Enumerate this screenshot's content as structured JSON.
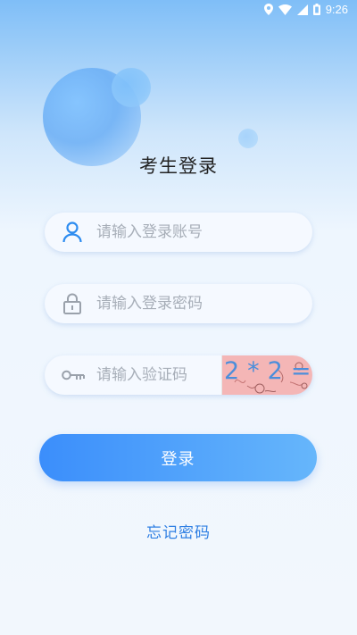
{
  "status_bar": {
    "time": "9:26",
    "icons": [
      "location-icon",
      "wifi-icon",
      "signal-icon",
      "battery-icon"
    ]
  },
  "page": {
    "title": "考生登录"
  },
  "form": {
    "username": {
      "placeholder": "请输入登录账号",
      "value": "",
      "icon": "user-icon"
    },
    "password": {
      "placeholder": "请输入登录密码",
      "value": "",
      "icon": "lock-icon"
    },
    "captcha": {
      "placeholder": "请输入验证码",
      "value": "",
      "icon": "key-icon",
      "image_text": "2*2=?"
    },
    "submit_label": "登录",
    "forgot_label": "忘记密码"
  },
  "colors": {
    "accent": "#3b8efb",
    "accent_light": "#66b6fb",
    "link": "#2f7fe3",
    "icon_blue": "#2d8cf0",
    "icon_gray": "#9aa1ab"
  }
}
